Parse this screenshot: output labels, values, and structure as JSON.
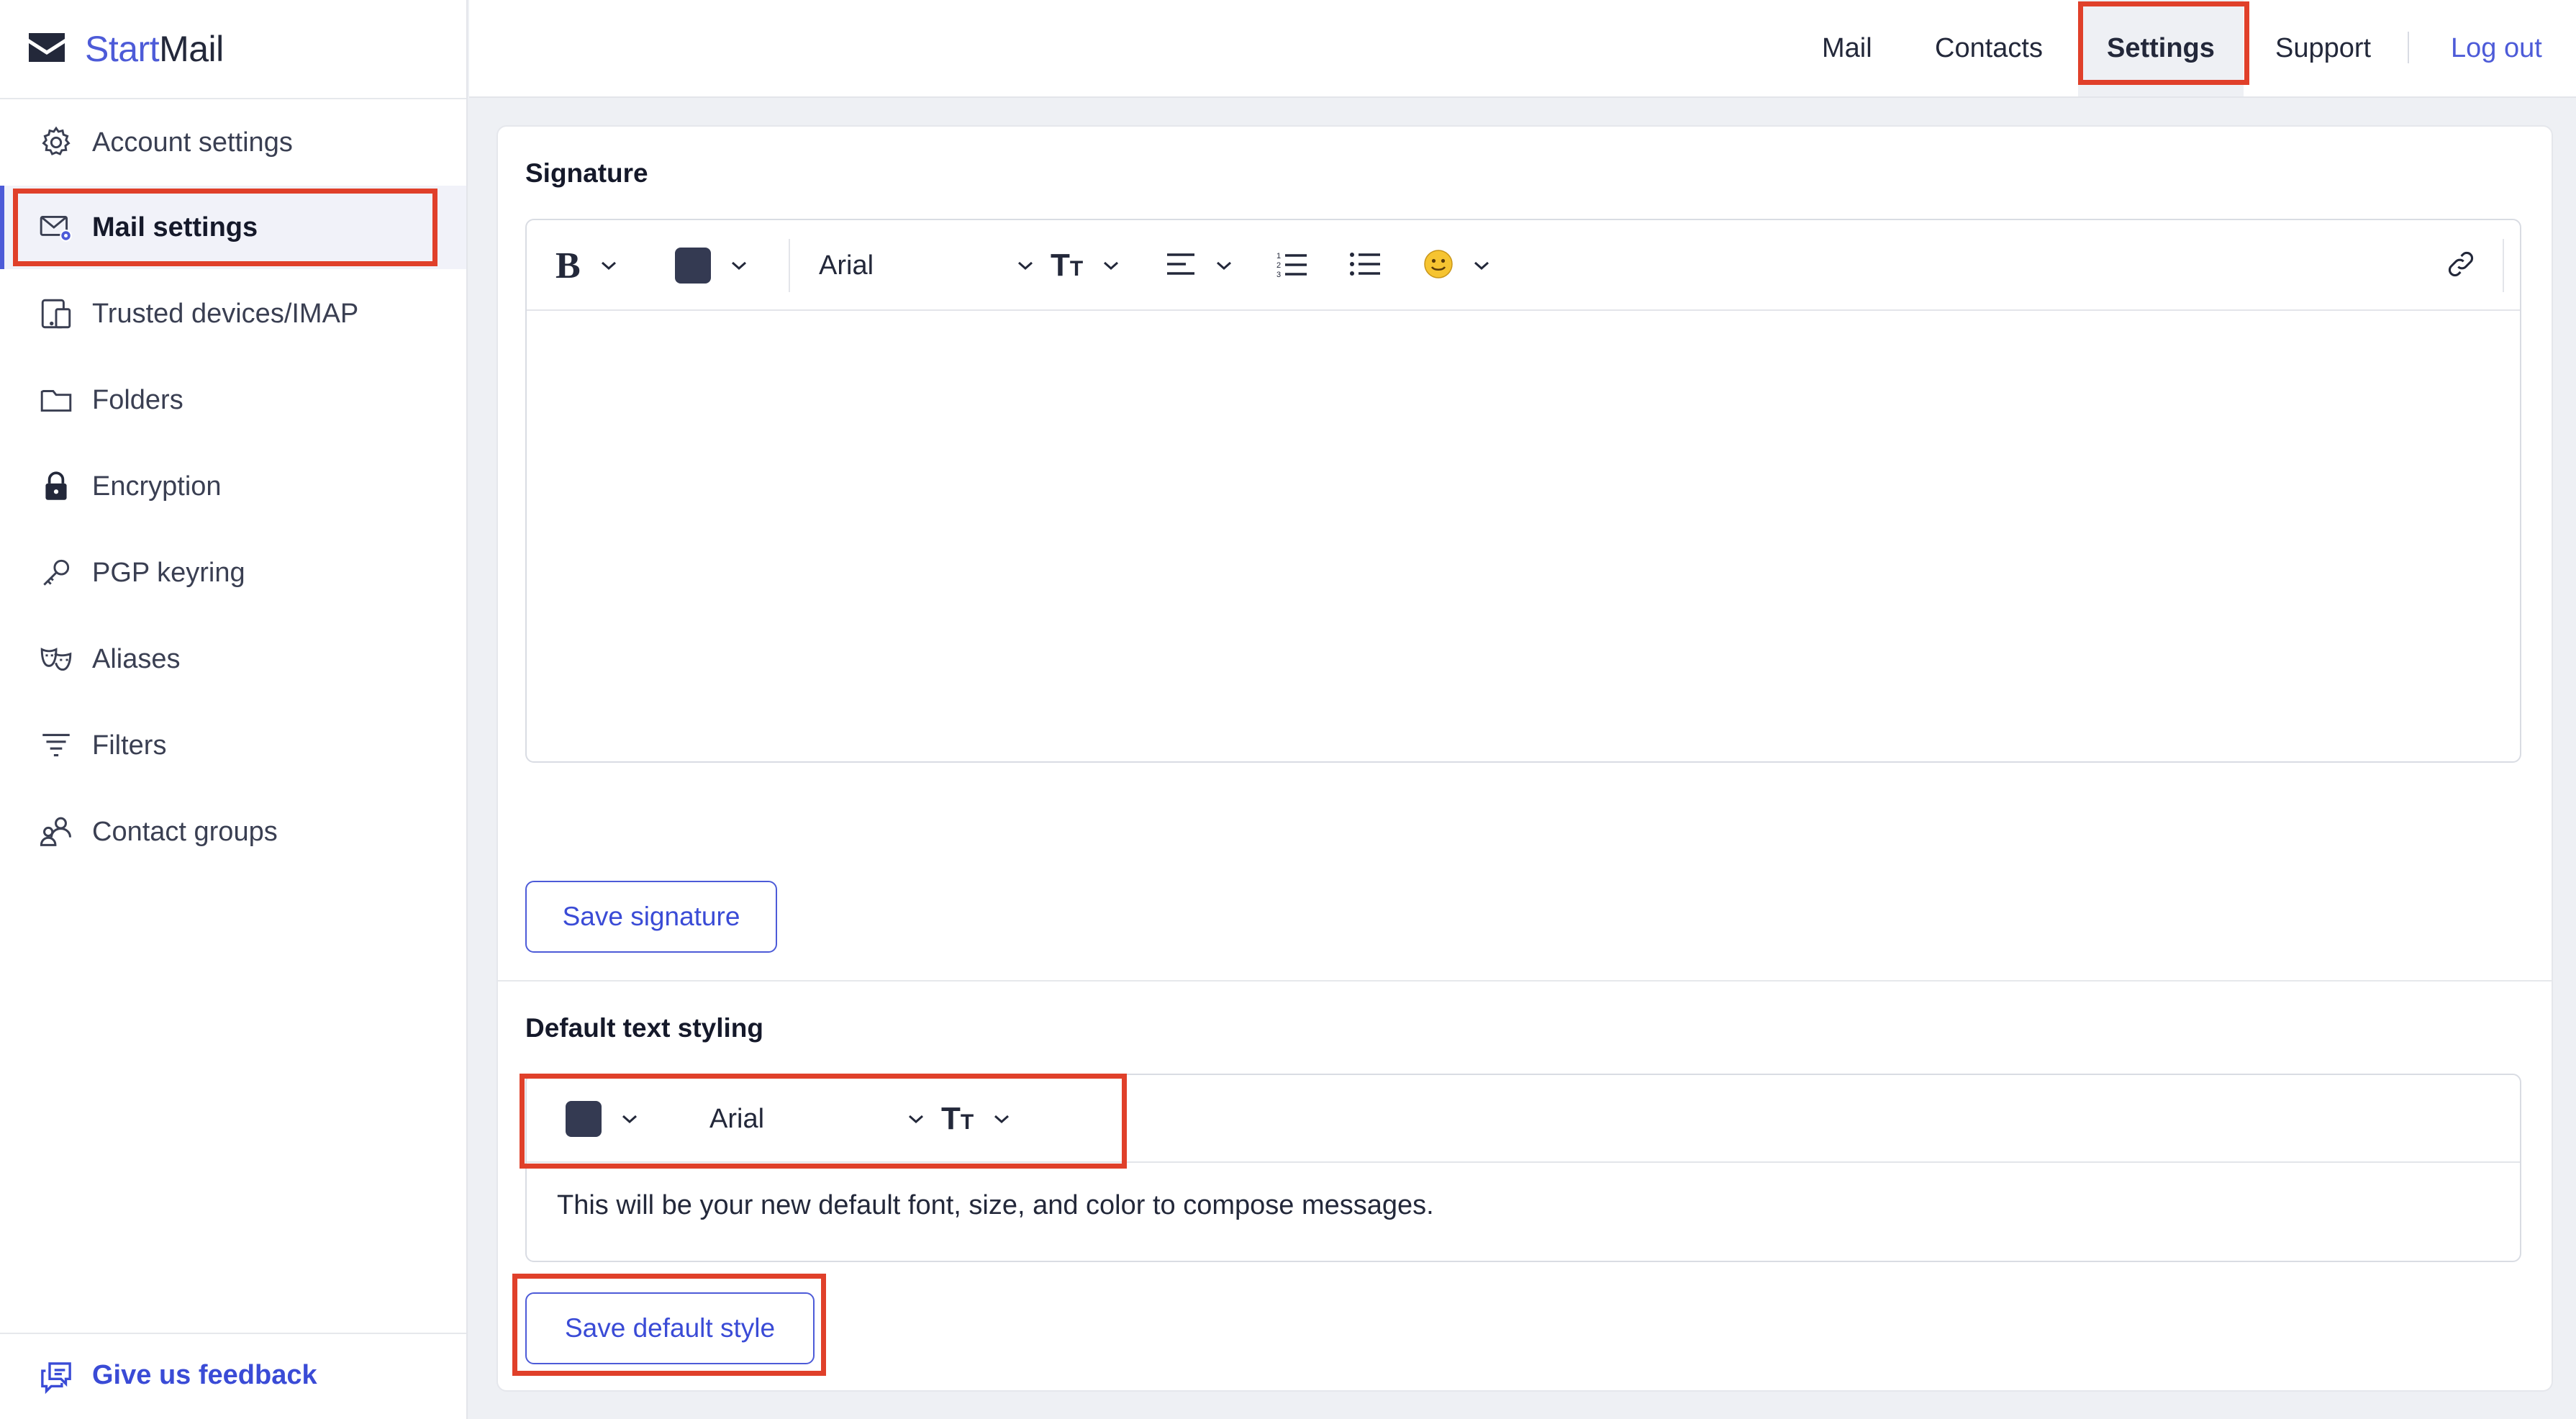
{
  "app": {
    "brand_start": "Start",
    "brand_mail": "Mail",
    "accent_color": "#4d5bd8",
    "highlight_color": "#e0402a"
  },
  "sidebar": {
    "items": [
      {
        "label": "Account settings",
        "icon": "gear-icon",
        "active": false
      },
      {
        "label": "Mail settings",
        "icon": "mail-gear-icon",
        "active": true
      },
      {
        "label": "Trusted devices/IMAP",
        "icon": "devices-icon",
        "active": false
      },
      {
        "label": "Folders",
        "icon": "folder-icon",
        "active": false
      },
      {
        "label": "Encryption",
        "icon": "lock-icon",
        "active": false
      },
      {
        "label": "PGP keyring",
        "icon": "key-icon",
        "active": false
      },
      {
        "label": "Aliases",
        "icon": "masks-icon",
        "active": false
      },
      {
        "label": "Filters",
        "icon": "filter-icon",
        "active": false
      },
      {
        "label": "Contact groups",
        "icon": "contact-group-icon",
        "active": false
      }
    ],
    "feedback_label": "Give us feedback"
  },
  "topnav": {
    "items": [
      {
        "label": "Mail",
        "active": false
      },
      {
        "label": "Contacts",
        "active": false
      },
      {
        "label": "Settings",
        "active": true
      },
      {
        "label": "Support",
        "active": false
      }
    ],
    "logout_label": "Log out"
  },
  "signature": {
    "title": "Signature",
    "font": "Arial",
    "text_color": "#343a52",
    "body": "",
    "save_label": "Save signature"
  },
  "default_style": {
    "title": "Default text styling",
    "font": "Arial",
    "text_color": "#343a52",
    "preview_text": "This will be your new default font, size, and color to compose messages.",
    "save_label": "Save default style"
  }
}
